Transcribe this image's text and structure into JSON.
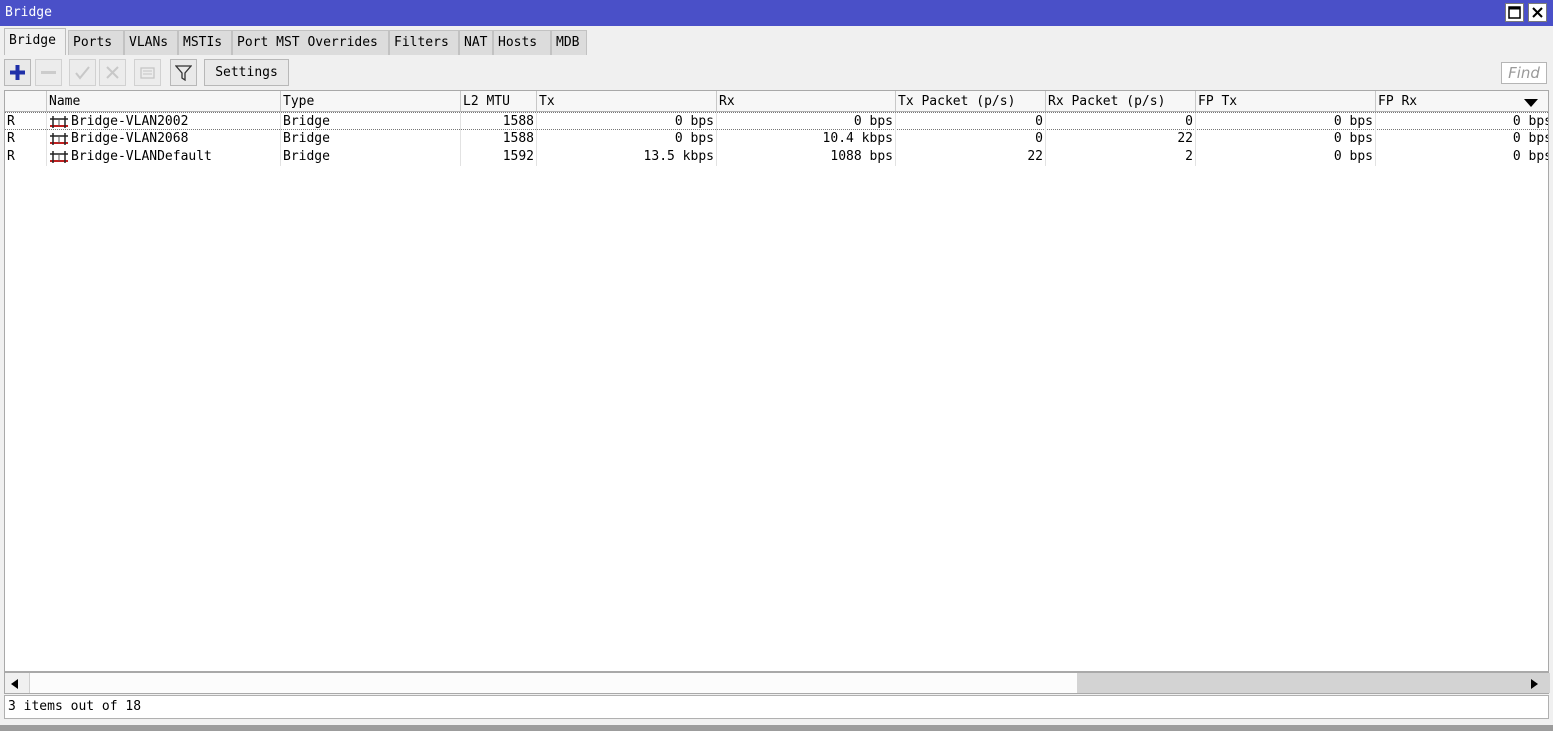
{
  "window": {
    "title": "Bridge",
    "maximize_icon": "maximize-icon",
    "close_icon": "close-icon",
    "title_bar_color": "#4a50c8"
  },
  "tabs": [
    {
      "label": "Bridge",
      "active": true
    },
    {
      "label": "Ports"
    },
    {
      "label": "VLANs"
    },
    {
      "label": "MSTIs"
    },
    {
      "label": "Port MST Overrides"
    },
    {
      "label": "Filters"
    },
    {
      "label": "NAT"
    },
    {
      "label": "Hosts"
    },
    {
      "label": "MDB"
    }
  ],
  "toolbar": {
    "buttons": [
      {
        "icon": "plus-icon",
        "enabled": true
      },
      {
        "icon": "minus-icon",
        "enabled": false
      },
      {
        "icon": "check-icon",
        "enabled": false
      },
      {
        "icon": "x-icon",
        "enabled": false
      },
      {
        "icon": "comment-icon",
        "enabled": false
      },
      {
        "icon": "filter-icon",
        "enabled": true
      }
    ],
    "settings_label": "Settings",
    "find_placeholder": "Find"
  },
  "table": {
    "columns": [
      "",
      "Name",
      "Type",
      "L2 MTU",
      "Tx",
      "Rx",
      "Tx Packet (p/s)",
      "Rx Packet (p/s)",
      "FP Tx",
      "FP Rx"
    ],
    "sort_indicator": "/",
    "rows": [
      {
        "flag": "R",
        "name": "Bridge-VLAN2002",
        "type": "Bridge",
        "l2mtu": "1588",
        "tx": "0 bps",
        "rx": "0 bps",
        "tx_pps": "0",
        "rx_pps": "0",
        "fp_tx": "0 bps",
        "fp_rx": "0 bps"
      },
      {
        "flag": "R",
        "name": "Bridge-VLAN2068",
        "type": "Bridge",
        "l2mtu": "1588",
        "tx": "0 bps",
        "rx": "10.4 kbps",
        "tx_pps": "0",
        "rx_pps": "22",
        "fp_tx": "0 bps",
        "fp_rx": "0 bps"
      },
      {
        "flag": "R",
        "name": "Bridge-VLANDefault",
        "type": "Bridge",
        "l2mtu": "1592",
        "tx": "13.5 kbps",
        "rx": "1088 bps",
        "tx_pps": "22",
        "rx_pps": "2",
        "fp_tx": "0 bps",
        "fp_rx": "0 bps"
      }
    ]
  },
  "status": {
    "text": "3 items out of 18"
  }
}
